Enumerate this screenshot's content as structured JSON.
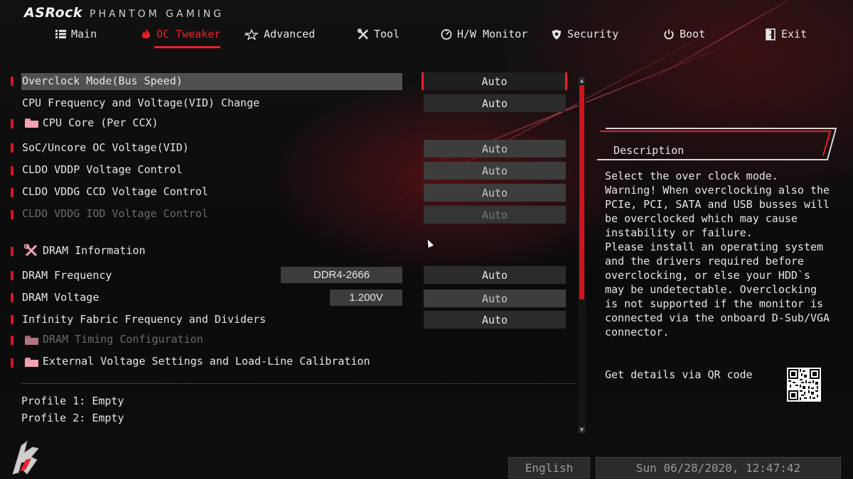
{
  "header": {
    "logo": "ASRock",
    "subtitle": "PHANTOM GAMING"
  },
  "tabs": [
    {
      "label": "Main",
      "icon": "list-icon"
    },
    {
      "label": "OC Tweaker",
      "icon": "flame-icon",
      "active": true
    },
    {
      "label": "Advanced",
      "icon": "star-icon"
    },
    {
      "label": "Tool",
      "icon": "tools-icon"
    },
    {
      "label": "H/W Monitor",
      "icon": "monitor-dial-icon"
    },
    {
      "label": "Security",
      "icon": "shield-icon"
    },
    {
      "label": "Boot",
      "icon": "power-icon"
    },
    {
      "label": "Exit",
      "icon": "exit-door-icon"
    }
  ],
  "settings": {
    "overclock_mode": {
      "label": "Overclock Mode(Bus Speed)",
      "value": "Auto"
    },
    "cpu_freq_voltage": {
      "label": "CPU Frequency and Voltage(VID) Change",
      "value": "Auto"
    },
    "cpu_core": {
      "label": "CPU Core (Per CCX)"
    },
    "soc_voltage": {
      "label": "SoC/Uncore OC Voltage(VID)",
      "value": "Auto"
    },
    "cldo_vddp": {
      "label": "CLDO VDDP Voltage Control",
      "value": "Auto"
    },
    "cldo_vddg_ccd": {
      "label": "CLDO VDDG CCD Voltage Control",
      "value": "Auto"
    },
    "cldo_vddg_iod": {
      "label": "CLDO VDDG IOD Voltage Control",
      "value": "Auto"
    },
    "dram_information": {
      "label": "DRAM Information"
    },
    "dram_frequency": {
      "label": "DRAM Frequency",
      "info": "DDR4-2666",
      "value": "Auto"
    },
    "dram_voltage": {
      "label": "DRAM Voltage",
      "info": "1.200V",
      "value": "Auto"
    },
    "infinity_fabric": {
      "label": "Infinity Fabric Frequency and Dividers",
      "value": "Auto"
    },
    "dram_timing": {
      "label": "DRAM Timing Configuration"
    },
    "external_voltage": {
      "label": "External Voltage Settings and Load-Line Calibration"
    }
  },
  "profiles": [
    "Profile 1: Empty",
    "Profile 2: Empty"
  ],
  "description": {
    "title": "Description",
    "text": "Select the over clock mode.\nWarning! When overclocking also the PCIe, PCI, SATA and USB busses will be overclocked which may cause instability or failure.\nPlease install an operating system and the drivers required before overclocking, or else your HDD`s may be undetectable. Overclocking is not supported if the monitor is connected via the onboard D-Sub/VGA connector.",
    "qr_label": "Get details via QR code"
  },
  "footer": {
    "language": "English",
    "datetime": "Sun 06/28/2020, 12:47:42"
  },
  "colors": {
    "accent": "#e8202b",
    "background": "#0b0b0c"
  }
}
